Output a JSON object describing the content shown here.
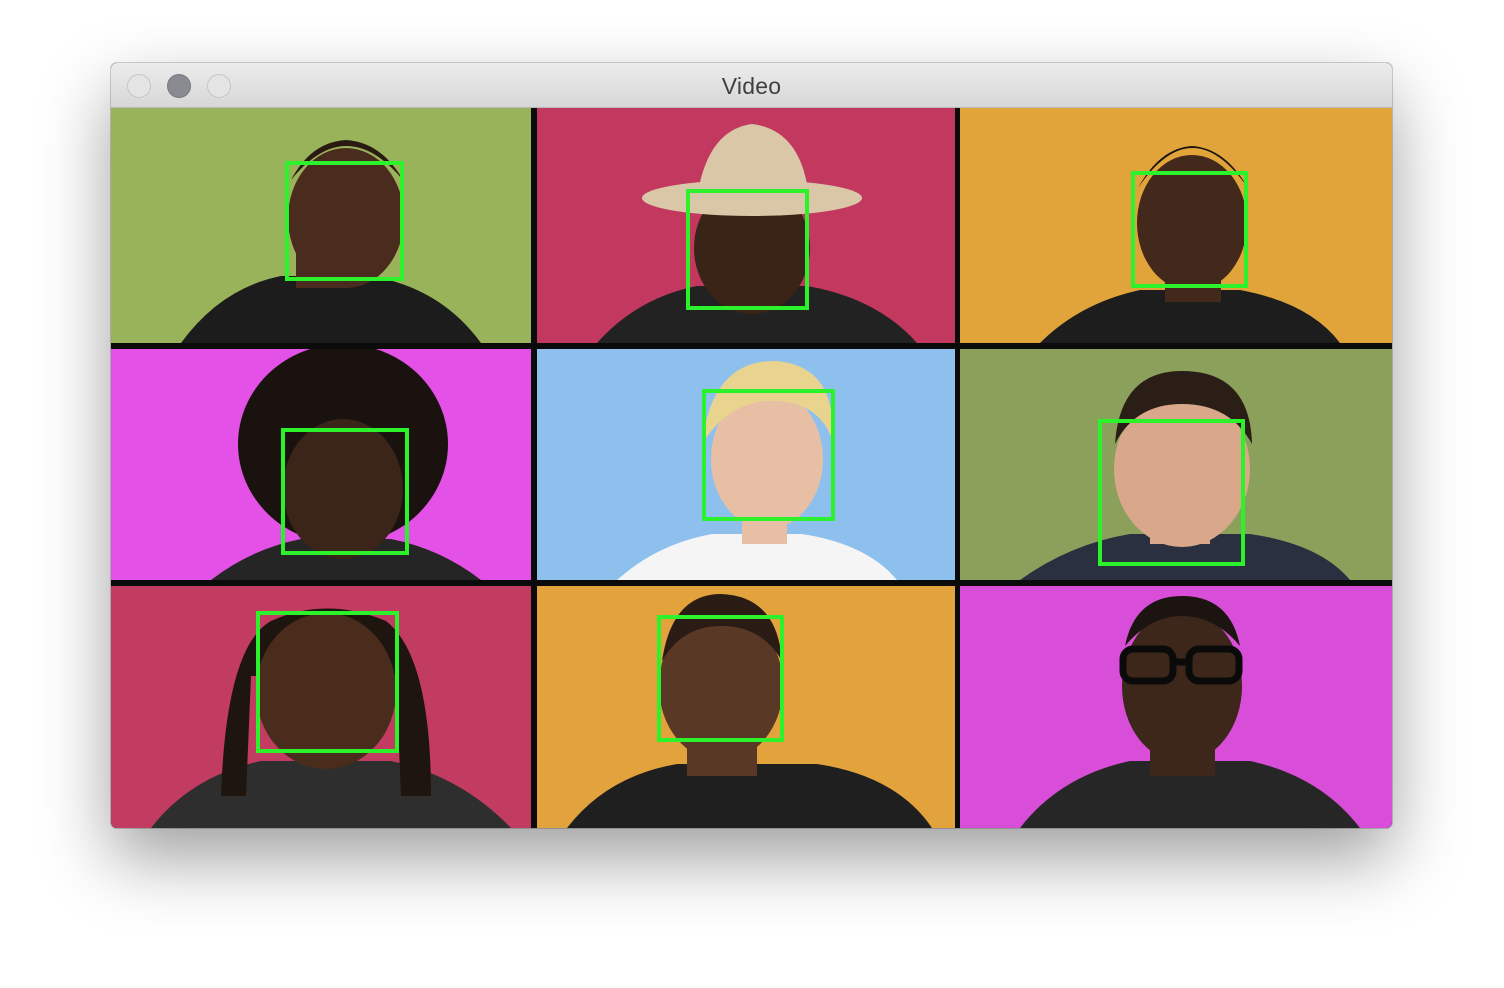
{
  "window": {
    "title": "Video"
  },
  "colors": {
    "face_box": "#2cf22c",
    "titlebar": "#e4e4e4"
  },
  "tiles": [
    {
      "id": "r1c1",
      "background": "#99b35a",
      "skin": "#4a2c1e",
      "shirt": "#1c1c1c",
      "hair": "#2a1a12"
    },
    {
      "id": "r1c2",
      "background": "#c2385e",
      "skin": "#3a2418",
      "shirt": "#222222",
      "hair": "#d9c7a8"
    },
    {
      "id": "r1c3",
      "background": "#e0a43a",
      "skin": "#43281c",
      "shirt": "#1d1d1d",
      "hair": "#1a1410"
    },
    {
      "id": "r2c1",
      "background": "#e451e6",
      "skin": "#3b2418",
      "shirt": "#252525",
      "hair": "#1a120e"
    },
    {
      "id": "r2c2",
      "background": "#8ec0ee",
      "skin": "#e6bfa4",
      "shirt": "#f5f5f5",
      "hair": "#e8d48e"
    },
    {
      "id": "r2c3",
      "background": "#8ba05a",
      "skin": "#d9a88a",
      "shirt": "#2a3040",
      "hair": "#2a1e16"
    },
    {
      "id": "r3c1",
      "background": "#c23c62",
      "skin": "#4a2c1c",
      "shirt": "#2e2e2e",
      "hair": "#1e150f"
    },
    {
      "id": "r3c2",
      "background": "#e2a33d",
      "skin": "#5a3826",
      "shirt": "#1f1f1f",
      "hair": "#2a1c14"
    },
    {
      "id": "r3c3",
      "background": "#d94ed8",
      "skin": "#3d261a",
      "shirt": "#262626",
      "hair": "#1c1410"
    }
  ]
}
